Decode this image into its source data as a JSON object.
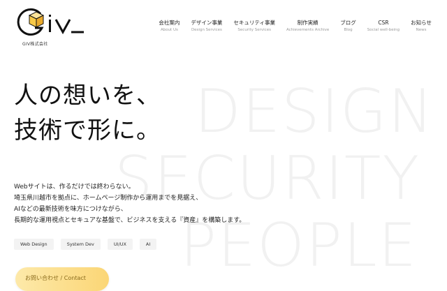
{
  "logo": {
    "wordmark": "GIV",
    "caption": "GIV株式会社",
    "accent_color": "#f7c948"
  },
  "nav": {
    "items": [
      {
        "jp": "会社案内",
        "en": "About Us"
      },
      {
        "jp": "デザイン事業",
        "en": "Design Services"
      },
      {
        "jp": "セキュリティ事業",
        "en": "Security Services"
      },
      {
        "jp": "制作実績",
        "en": "Achievements Archive"
      },
      {
        "jp": "ブログ",
        "en": "Blog"
      },
      {
        "jp": "CSR",
        "en": "Social well-being"
      },
      {
        "jp": "お知らせ",
        "en": "News"
      }
    ]
  },
  "background_words": [
    "DESIGN",
    "SECURITY",
    "PEOPLE"
  ],
  "hero": {
    "line1": "人の想いを、",
    "line2": "技術で形に。"
  },
  "description": {
    "lines": [
      "Webサイトは、作るだけでは終わらない。",
      "埼玉県川越市を拠点に、ホームページ制作から運用までを見据え、",
      "AIなどの最新技術を味方につけながら、",
      "長期的な運用視点とセキュアな基盤で、ビジネスを支える『資産』を構築します。"
    ]
  },
  "tags": [
    "Web Design",
    "System Dev",
    "UI/UX",
    "AI"
  ],
  "cta": {
    "label": "お問い合わせ / Contact"
  }
}
